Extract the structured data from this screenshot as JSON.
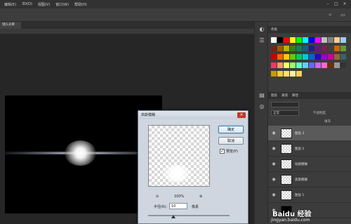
{
  "menubar": {
    "items": [
      "编辑(E)",
      "3D(D)",
      "视图(V)",
      "窗口(W)",
      "帮助(H)"
    ]
  },
  "document": {
    "tab_label": "镜头光晕"
  },
  "panels": {
    "swatches_title": "色板",
    "layers_tabs": [
      "图层",
      "通道",
      "路径"
    ],
    "blend_mode": "正常",
    "opacity_label": "不透明度",
    "fill_label": "填充",
    "layers": [
      {
        "name": "图层 3",
        "selected": true
      },
      {
        "name": "图层 2",
        "selected": false
      },
      {
        "name": "动感模糊",
        "selected": false
      },
      {
        "name": "高斯模糊",
        "selected": false
      },
      {
        "name": "图层 1",
        "selected": false
      },
      {
        "name": "",
        "selected": false
      }
    ]
  },
  "dialog": {
    "title": "高斯模糊",
    "ok": "确定",
    "cancel": "取消",
    "preview_label": "预览(P)",
    "preview_checked": true,
    "zoom_out": "⊖",
    "zoom_value": "100%",
    "zoom_in": "⊕",
    "radius_label": "半径(R):",
    "radius_value": "10",
    "radius_unit": "像素",
    "radius_slider_fraction": 0.31
  },
  "watermark": {
    "brand": "Baidu 经验",
    "url": "jingyan.baidu.com"
  },
  "colors": {
    "menubar": "#323232",
    "canvas_bg": "#262626",
    "accent_focus": "#3c7fb1"
  }
}
